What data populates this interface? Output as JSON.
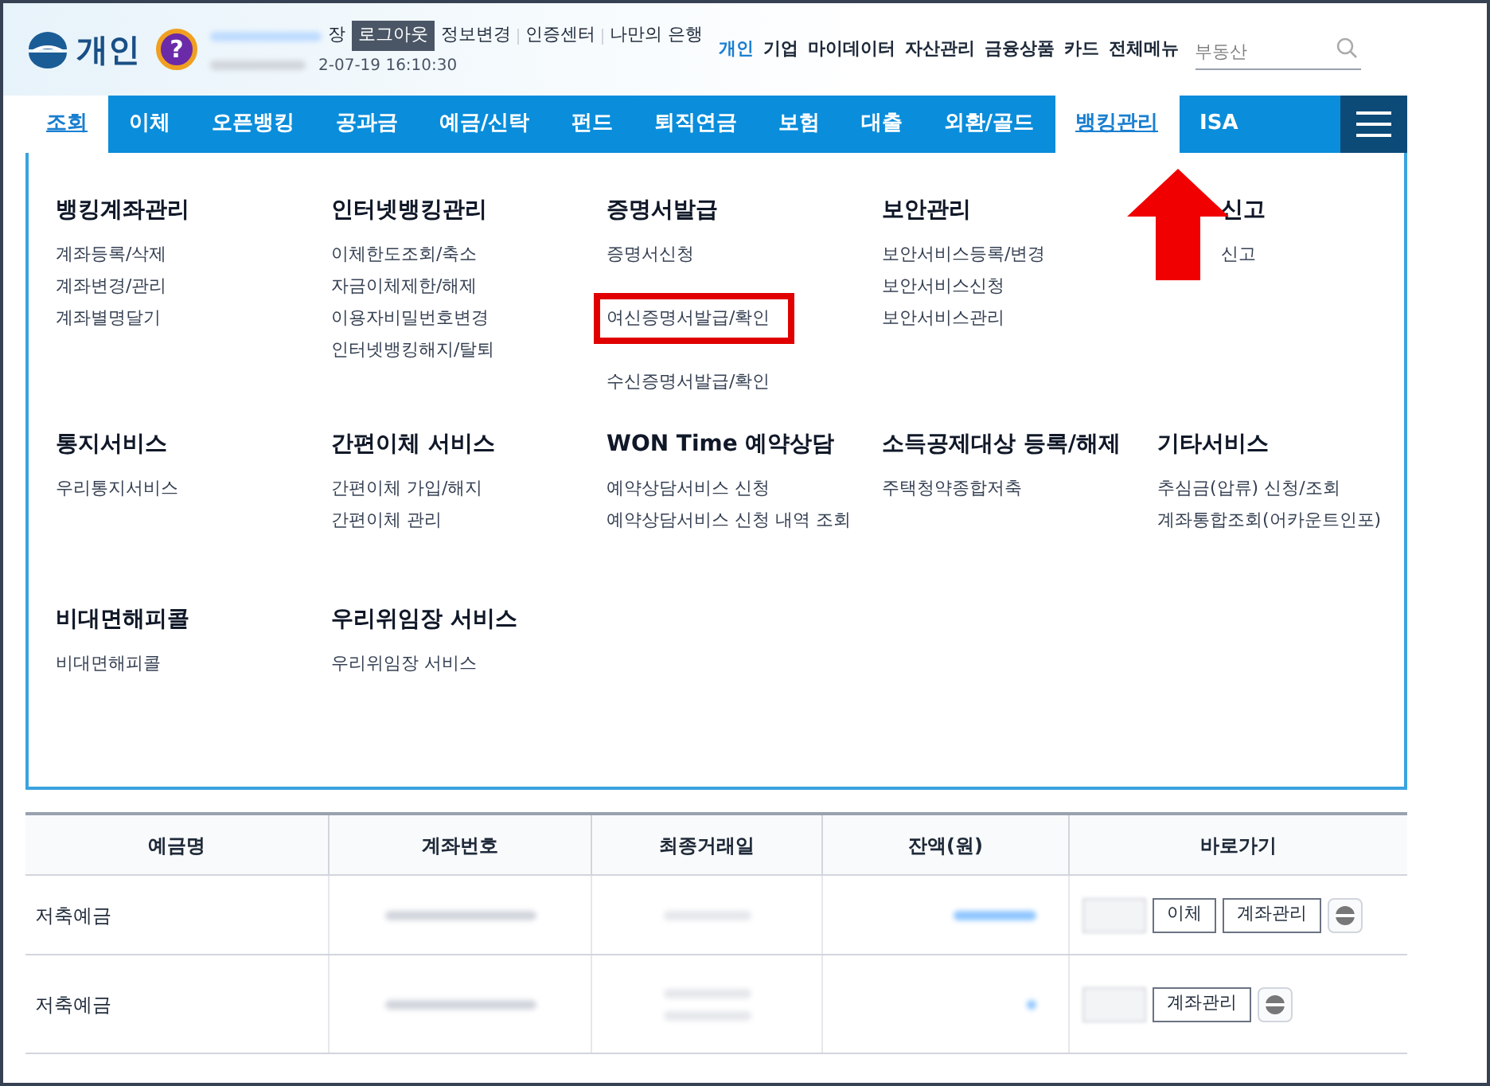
{
  "header": {
    "logo_text": "개인",
    "help_badge": "?",
    "user_suffix": "장",
    "logout": "로그아웃",
    "links": [
      "정보변경",
      "인증센터",
      "나만의 은행"
    ],
    "login_time": "2-07-19 16:10:30"
  },
  "top_nav": [
    {
      "label": "개인",
      "selected": true
    },
    {
      "label": "기업",
      "selected": false
    },
    {
      "label": "마이데이터",
      "selected": false
    },
    {
      "label": "자산관리",
      "selected": false
    },
    {
      "label": "금융상품",
      "selected": false
    },
    {
      "label": "카드",
      "selected": false
    },
    {
      "label": "전체메뉴",
      "selected": false
    }
  ],
  "search": {
    "placeholder": "부동산"
  },
  "main_nav": [
    {
      "label": "조회",
      "selected": true
    },
    {
      "label": "이체",
      "selected": false
    },
    {
      "label": "오픈뱅킹",
      "selected": false
    },
    {
      "label": "공과금",
      "selected": false
    },
    {
      "label": "예금/신탁",
      "selected": false
    },
    {
      "label": "펀드",
      "selected": false
    },
    {
      "label": "퇴직연금",
      "selected": false
    },
    {
      "label": "보험",
      "selected": false
    },
    {
      "label": "대출",
      "selected": false
    },
    {
      "label": "외환/골드",
      "selected": false
    },
    {
      "label": "뱅킹관리",
      "selected": true
    },
    {
      "label": "ISA",
      "selected": false
    }
  ],
  "menu_groups": [
    {
      "title": "뱅킹계좌관리",
      "items": [
        {
          "kind": "link",
          "label": "계좌등록/삭제"
        },
        {
          "kind": "link",
          "label": "계좌변경/관리"
        },
        {
          "kind": "link",
          "label": "계좌별명달기"
        }
      ]
    },
    {
      "title": "인터넷뱅킹관리",
      "items": [
        {
          "kind": "link",
          "label": "이체한도조회/축소"
        },
        {
          "kind": "link",
          "label": "자금이체제한/해제"
        },
        {
          "kind": "link",
          "label": "이용자비밀번호변경"
        },
        {
          "kind": "link",
          "label": "인터넷뱅킹해지/탈퇴"
        }
      ]
    },
    {
      "title": "증명서발급",
      "items": [
        {
          "kind": "link",
          "label": "증명서신청"
        },
        {
          "kind": "obscured"
        },
        {
          "kind": "highlighted",
          "label": "여신증명서발급/확인"
        },
        {
          "kind": "obscured"
        },
        {
          "kind": "link",
          "label": "수신증명서발급/확인"
        }
      ]
    },
    {
      "title": "보안관리",
      "items": [
        {
          "kind": "link",
          "label": "보안서비스등록/변경"
        },
        {
          "kind": "link",
          "label": "보안서비스신청"
        },
        {
          "kind": "link",
          "label": "보안서비스관리"
        }
      ]
    },
    {
      "title": "신고",
      "items": [
        {
          "kind": "link",
          "label": "신고"
        }
      ]
    },
    {
      "title": "통지서비스",
      "items": [
        {
          "kind": "link",
          "label": "우리통지서비스"
        }
      ]
    },
    {
      "title": "간편이체 서비스",
      "items": [
        {
          "kind": "link",
          "label": "간편이체 가입/해지"
        },
        {
          "kind": "link",
          "label": "간편이체 관리"
        }
      ]
    },
    {
      "title": "WON Time 예약상담",
      "items": [
        {
          "kind": "link",
          "label": "예약상담서비스 신청"
        },
        {
          "kind": "link",
          "label": "예약상담서비스 신청 내역 조회"
        }
      ]
    },
    {
      "title": "소득공제대상 등록/해제",
      "items": [
        {
          "kind": "link",
          "label": "주택청약종합저축"
        }
      ]
    },
    {
      "title": "기타서비스",
      "items": [
        {
          "kind": "link",
          "label": "추심금(압류) 신청/조회"
        },
        {
          "kind": "link",
          "label": "계좌통합조회(어카운트인포)"
        }
      ]
    },
    {
      "title": "비대면해피콜",
      "items": [
        {
          "kind": "link",
          "label": "비대면해피콜"
        }
      ]
    },
    {
      "title": "우리위임장 서비스",
      "items": [
        {
          "kind": "link",
          "label": "우리위임장 서비스"
        }
      ]
    }
  ],
  "table": {
    "columns": [
      "예금명",
      "계좌번호",
      "최종거래일",
      "잔액(원)",
      "바로가기"
    ],
    "rows": [
      {
        "name": "저축예금",
        "actions": [
          "이체",
          "계좌관리"
        ]
      },
      {
        "name": "저축예금",
        "actions": [
          "계좌관리"
        ]
      }
    ]
  }
}
